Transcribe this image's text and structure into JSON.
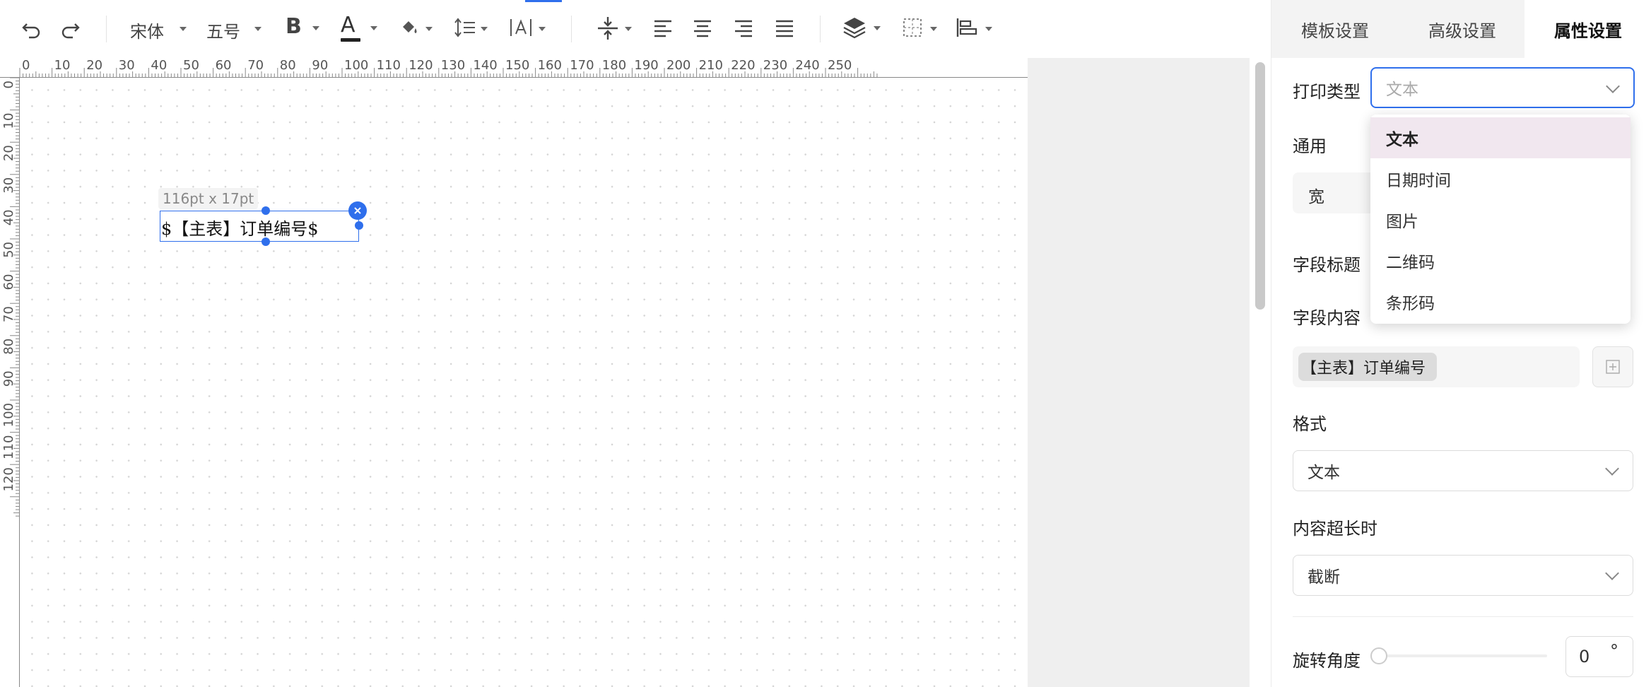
{
  "toolbar": {
    "font_family": "宋体",
    "font_size": "五号",
    "icons": [
      "undo-icon",
      "redo-icon",
      "bold-icon",
      "font-color-icon",
      "fill-color-icon",
      "line-spacing-icon",
      "letter-spacing-icon",
      "vertical-distribute-icon",
      "align-left-icon",
      "align-center-icon",
      "align-right-icon",
      "align-justify-icon",
      "layers-icon",
      "border-icon",
      "align-objects-icon"
    ]
  },
  "ruler": {
    "h_labels": [
      "0",
      "10",
      "20",
      "30",
      "40",
      "50",
      "60",
      "70",
      "80",
      "90",
      "100",
      "110",
      "120",
      "130",
      "140",
      "150",
      "160",
      "170",
      "180",
      "190",
      "200",
      "210",
      "220",
      "230",
      "240",
      "250"
    ],
    "v_labels": [
      "0",
      "10",
      "20",
      "30",
      "40",
      "50",
      "60",
      "70",
      "80",
      "90",
      "100",
      "110",
      "120"
    ]
  },
  "canvas": {
    "size_tooltip": "116pt x 17pt",
    "selected_field_text": "$【主表】订单编号$"
  },
  "panel": {
    "tabs": [
      {
        "label": "模板设置",
        "active": false
      },
      {
        "label": "高级设置",
        "active": false
      },
      {
        "label": "属性设置",
        "active": true
      }
    ],
    "print_type_label": "打印类型",
    "print_type_placeholder": "文本",
    "general_label": "通用",
    "width_label": "宽",
    "field_title_label": "字段标题",
    "field_content_label": "字段内容",
    "field_chip": "【主表】订单编号",
    "format_label": "格式",
    "format_value": "文本",
    "overflow_label": "内容超长时",
    "overflow_value": "截断",
    "rotation_label": "旋转角度",
    "rotation_value": "0",
    "rotation_unit": "°",
    "rotation_level": 0,
    "dropdown_options": [
      {
        "label": "文本",
        "selected": true
      },
      {
        "label": "日期时间",
        "selected": false
      },
      {
        "label": "图片",
        "selected": false
      },
      {
        "label": "二维码",
        "selected": false
      },
      {
        "label": "条形码",
        "selected": false
      }
    ]
  },
  "colors": {
    "accent": "#2f6fec",
    "selected_option_bg": "#f1e7ef",
    "canvas_gray": "#efefef"
  }
}
